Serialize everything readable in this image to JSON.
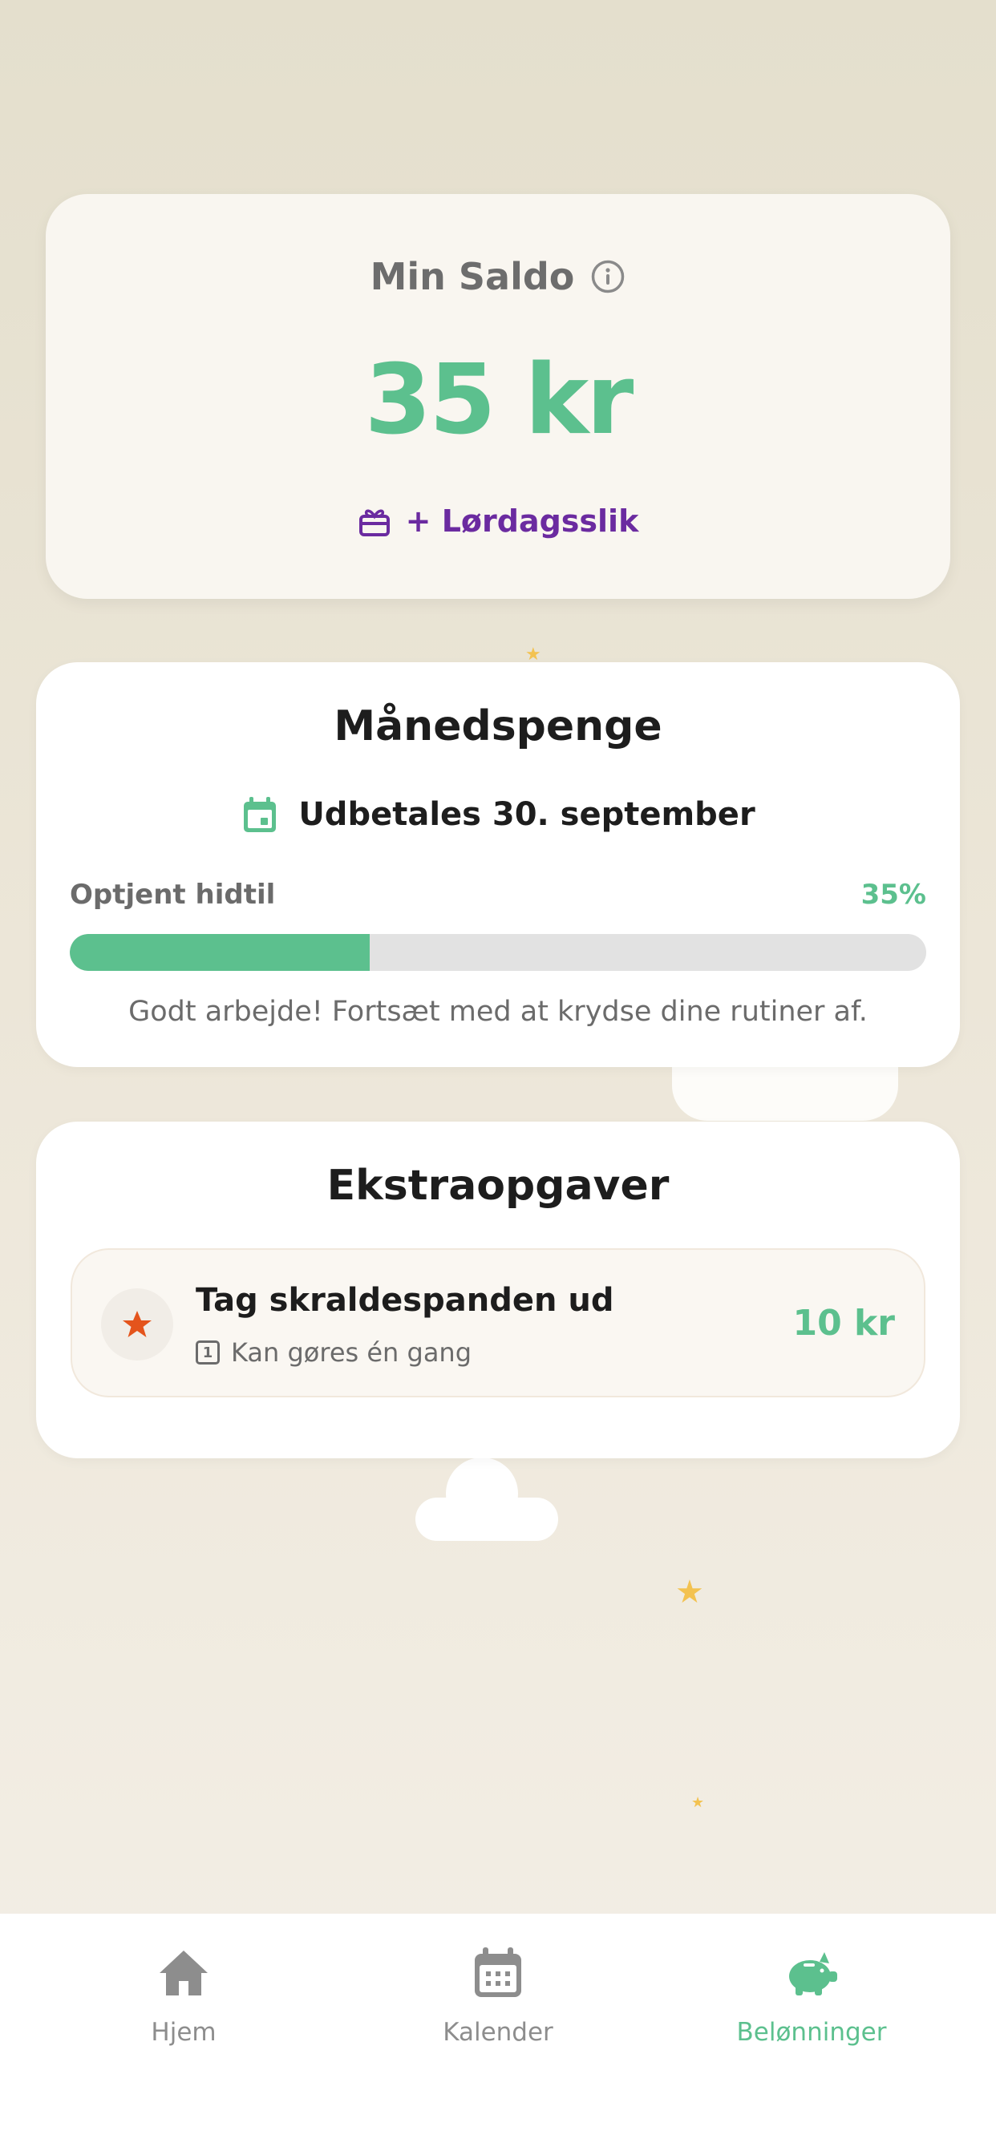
{
  "balance": {
    "title": "Min Saldo",
    "amount": "35 kr",
    "bonus": "+ Lørdagsslik"
  },
  "allowance": {
    "title": "Månedspenge",
    "payout": "Udbetales 30. september",
    "earned_label": "Optjent hidtil",
    "earned_percent_label": "35%",
    "progress": 0.35,
    "message": "Godt arbejde! Fortsæt med at krydse dine rutiner af."
  },
  "extra_tasks": {
    "title": "Ekstraopgaver",
    "items": [
      {
        "title": "Tag skraldespanden ud",
        "frequency_badge": "1",
        "frequency": "Kan gøres én gang",
        "reward": "10 kr"
      }
    ]
  },
  "nav": {
    "items": [
      {
        "label": "Hjem",
        "icon": "home-icon",
        "active": false
      },
      {
        "label": "Kalender",
        "icon": "calendar-icon",
        "active": false
      },
      {
        "label": "Belønninger",
        "icon": "piggy-bank-icon",
        "active": true
      }
    ]
  },
  "colors": {
    "accent": "#5cc08e",
    "bonus": "#6b2ba0",
    "task_star": "#e4541c",
    "deco_star": "#f3c250",
    "nav_inactive": "#8d8d8d"
  }
}
